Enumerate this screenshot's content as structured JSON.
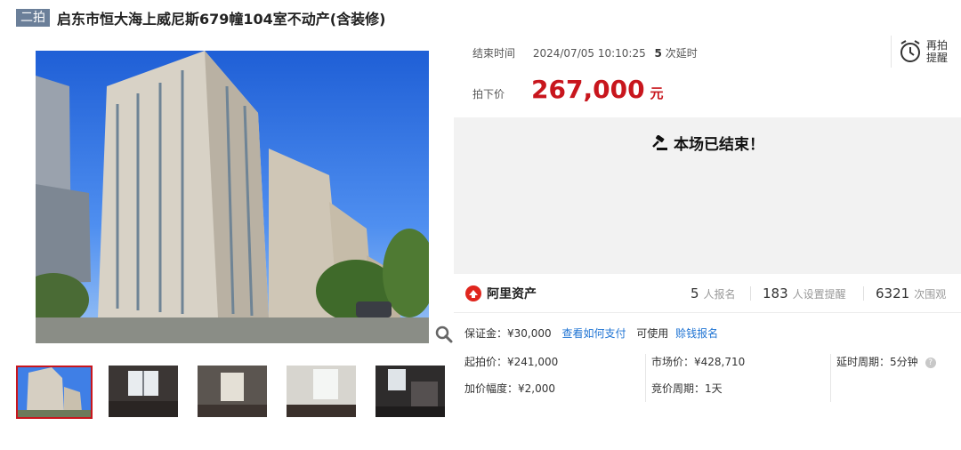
{
  "header": {
    "badge": "二拍",
    "title": "启东市恒大海上威尼斯679幢104室不动产(含装修)"
  },
  "auction": {
    "end_label": "结束时间",
    "end_time": "2024/07/05 10:10:25",
    "delay_count": "5",
    "delay_suffix": "次延时",
    "remind_label": "再拍提醒",
    "final_price_label": "拍下价",
    "final_price": "267,000",
    "final_price_unit": "元",
    "ended_text": "本场已结束！"
  },
  "platform": {
    "name": "阿里资产"
  },
  "stats": {
    "signups": "5",
    "signups_label": "人报名",
    "reminders": "183",
    "reminders_label": "人设置提醒",
    "views": "6321",
    "views_label": "次围观"
  },
  "deposit": {
    "label": "保证金：¥30,000",
    "how_to_pay": "查看如何支付",
    "usable_label": "可使用",
    "credit_signup": "赊钱报名"
  },
  "details": {
    "start_price": "起拍价：¥241,000",
    "market_price": "市场价：¥428,710",
    "delay_period": "延时周期：5分钟",
    "increment": "加价幅度：¥2,000",
    "bid_period": "竞价周期：1天"
  },
  "icons": {
    "alarm": "alarm-clock-icon",
    "gavel": "gavel-icon",
    "zoom": "magnifier-icon",
    "help": "question-icon",
    "logo": "ali-asset-logo-icon"
  },
  "colors": {
    "price_red": "#c8161d",
    "link_blue": "#1e73d3",
    "badge_slate": "#6b7f99",
    "ended_bg": "#f2f2f2"
  }
}
